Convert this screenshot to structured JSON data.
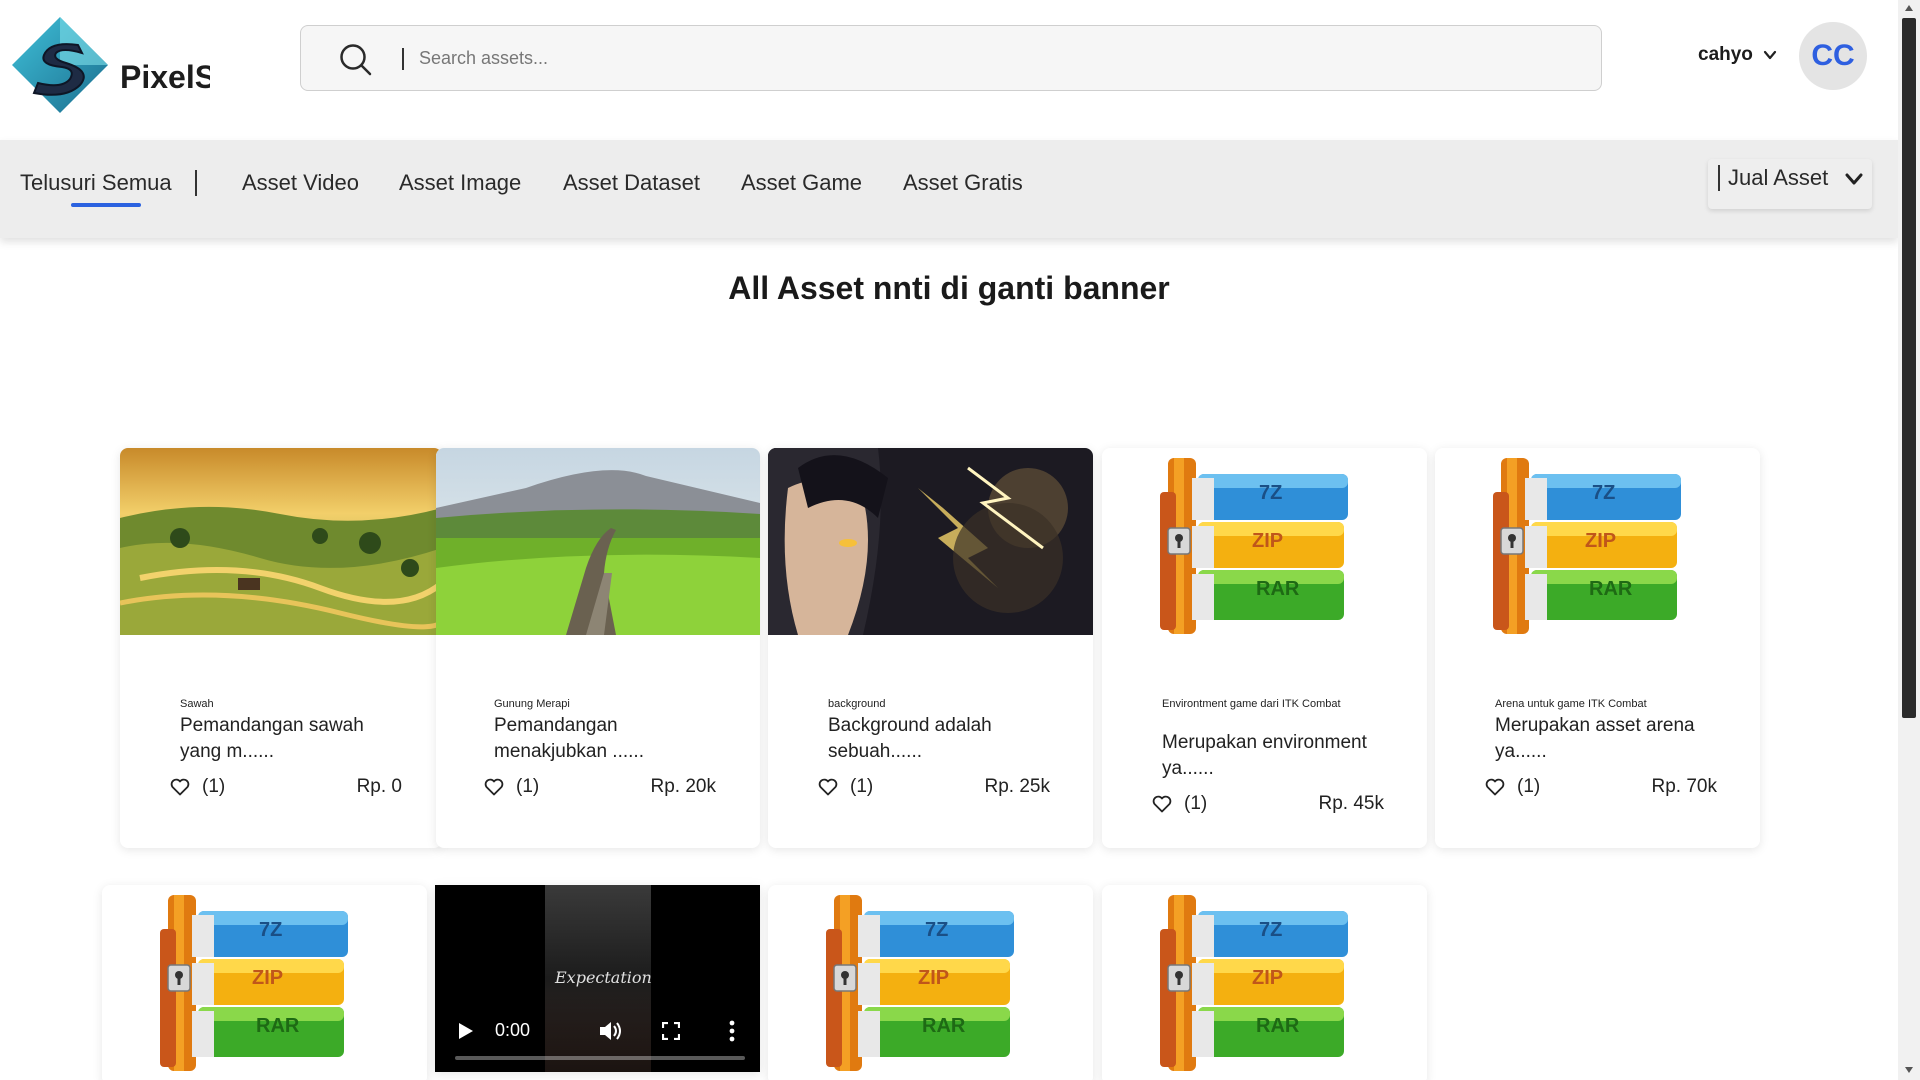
{
  "brand": {
    "name": "PixelS"
  },
  "search": {
    "placeholder": "Search assets..."
  },
  "user": {
    "name": "cahyo",
    "initials": "CC"
  },
  "nav": {
    "items": [
      {
        "label": "Telusuri Semua",
        "active": true
      },
      {
        "label": "Asset Video"
      },
      {
        "label": "Asset Image"
      },
      {
        "label": "Asset Dataset"
      },
      {
        "label": "Asset Game"
      },
      {
        "label": "Asset Gratis"
      }
    ],
    "sell_label": "Jual Asset"
  },
  "banner": {
    "title": "All Asset nnti di ganti banner"
  },
  "cards": [
    {
      "category": "Sawah",
      "title": "Pemandangan sawah yang m......",
      "likes": "(1)",
      "price": "Rp. 0",
      "media": "image"
    },
    {
      "category": "Gunung Merapi",
      "title": "Pemandangan menakjubkan ......",
      "likes": "(1)",
      "price": "Rp. 20k",
      "media": "image"
    },
    {
      "category": "background",
      "title": "Background adalah sebuah......",
      "likes": "(1)",
      "price": "Rp. 25k",
      "media": "image"
    },
    {
      "category": "Environtment game dari ITK Combat",
      "title": "Merupakan environment ya......",
      "likes": "(1)",
      "price": "Rp. 45k",
      "media": "archive-icon"
    },
    {
      "category": "Arena untuk game ITK Combat",
      "title": "Merupakan asset arena ya......",
      "likes": "(1)",
      "price": "Rp. 70k",
      "media": "archive-icon"
    }
  ],
  "row2": [
    {
      "media": "archive-icon"
    },
    {
      "media": "video",
      "video_caption": "Expectation",
      "time": "0:00",
      "progress": 0
    },
    {
      "media": "archive-icon"
    },
    {
      "media": "archive-icon"
    }
  ],
  "archive_labels": {
    "top": "7Z",
    "middle": "ZIP",
    "bottom": "RAR"
  },
  "colors": {
    "accent": "#2b62e0",
    "avatar_text": "#2e5fe0",
    "nav_bg": "#ededed"
  }
}
